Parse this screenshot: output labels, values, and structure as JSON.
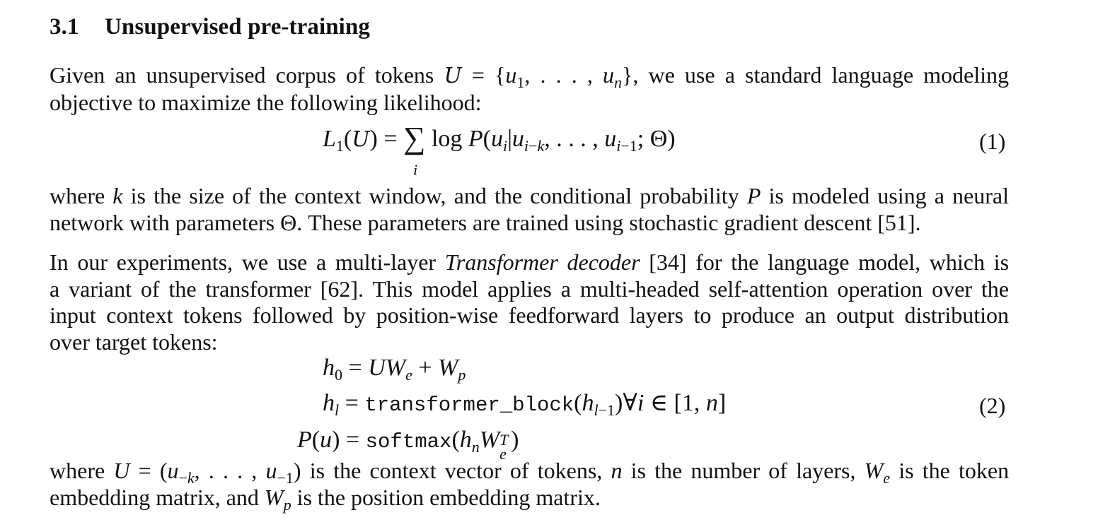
{
  "section": {
    "number": "3.1",
    "title": "Unsupervised pre-training"
  },
  "para1": {
    "l1_a": "Given an unsupervised corpus of tokens ",
    "l1_b": ", we use a standard language modeling",
    "l2": "objective to maximize the following likelihood:"
  },
  "eq1": {
    "label": "(1)"
  },
  "para2": {
    "l1_a": "where ",
    "l1_b": " is the size of the context window, and the conditional probability ",
    "l1_c": " is modeled using a neural",
    "l2_a": "network with parameters ",
    "l2_b": ". These parameters are trained using stochastic gradient descent [51]."
  },
  "para3": {
    "l1_a": "In our experiments, we use a multi-layer ",
    "l1_em": "Transformer decoder",
    "l1_b": " [34] for the language model, which is",
    "l2": "a variant of the transformer [62]. This model applies a multi-headed self-attention operation over the",
    "l3": "input context tokens followed by position-wise feedforward layers to produce an output distribution",
    "l4": "over target tokens:"
  },
  "eq2": {
    "label": "(2)",
    "fn_block": "transformer_block",
    "fn_softmax": "softmax"
  },
  "para4": {
    "l1_a": "where ",
    "l1_b": " is the context vector of tokens, ",
    "l1_c": " is the number of layers, ",
    "l1_d": " is the token",
    "l2_a": "embedding matrix, and ",
    "l2_b": " is the position embedding matrix."
  }
}
